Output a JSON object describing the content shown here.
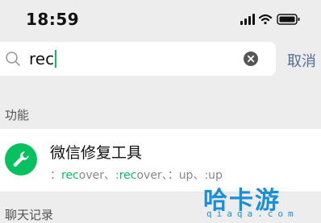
{
  "status_bar": {
    "time": "18:59"
  },
  "search": {
    "query": "rec",
    "cancel_label": "取消"
  },
  "sections": {
    "functions": "功能",
    "chat_history": "聊天记录"
  },
  "result": {
    "title": "微信修复工具",
    "subtitle_parts": [
      {
        "text": "：",
        "hl": false
      },
      {
        "text": "rec",
        "hl": true
      },
      {
        "text": "over、:",
        "hl": false
      },
      {
        "text": "rec",
        "hl": true
      },
      {
        "text": "over、：up、:up",
        "hl": false
      }
    ],
    "icon": "wrench-icon"
  },
  "watermark": {
    "text": "哈卡游",
    "sub": "qiaqa.com"
  },
  "colors": {
    "accent": "#07c160",
    "link": "#576b95",
    "watermark": "#1a8fd8"
  }
}
